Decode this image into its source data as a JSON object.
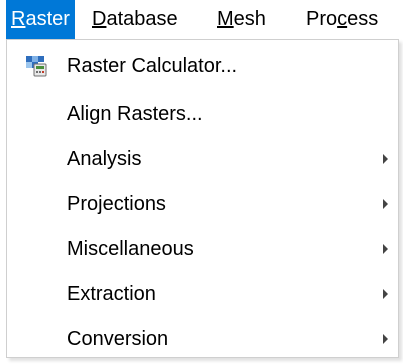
{
  "menubar": {
    "raster": {
      "ul": "R",
      "rest": "aster"
    },
    "database": {
      "ul": "D",
      "rest": "atabase"
    },
    "mesh": {
      "ul": "M",
      "rest": "esh"
    },
    "processing": {
      "pre": "Pro",
      "ul": "c",
      "rest": "ess"
    }
  },
  "colors": {
    "active_menu_bg": "#0078d7",
    "active_menu_text": "#ffffff"
  },
  "dropdown": {
    "items": [
      {
        "label": "Raster Calculator...",
        "icon": "raster-calculator-icon",
        "submenu": false
      },
      {
        "label": "Align Rasters...",
        "submenu": false
      },
      {
        "label": "Analysis",
        "submenu": true
      },
      {
        "label": "Projections",
        "submenu": true
      },
      {
        "label": "Miscellaneous",
        "submenu": true
      },
      {
        "label": "Extraction",
        "submenu": true
      },
      {
        "label": "Conversion",
        "submenu": true
      }
    ]
  }
}
